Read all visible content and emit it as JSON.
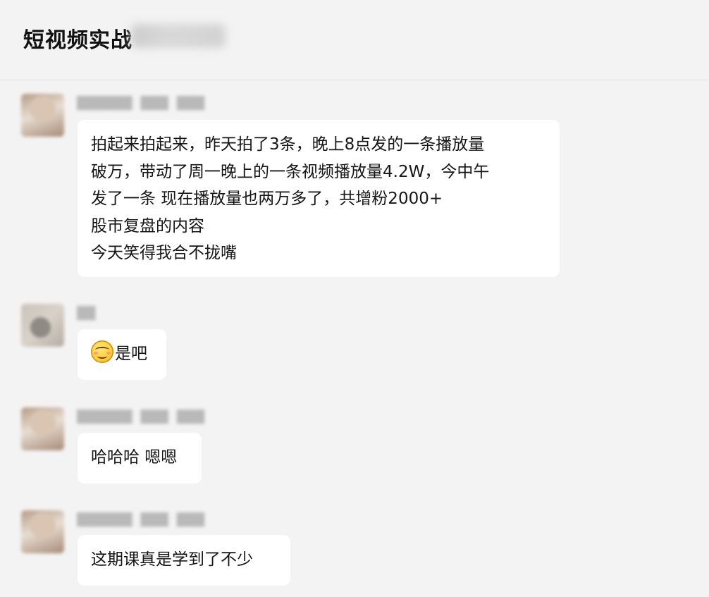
{
  "chat": {
    "title": "短视频实战",
    "title_redacted": "████"
  },
  "messages": [
    {
      "sender": {
        "name": "██████",
        "tag1": "███",
        "tag2": "███"
      },
      "lines": [
        "拍起来拍起来，昨天拍了3条，晚上8点发的一条播放量",
        "破万，带动了周一晚上的一条视频播放量4.2W，今中午",
        "发了一条 现在播放量也两万多了，共增粉2000+",
        "股市复盘的内容",
        "今天笑得我合不拢嘴"
      ]
    },
    {
      "sender": {
        "name": "██"
      },
      "emoji": "smirk-emoji",
      "lines": [
        "是吧"
      ]
    },
    {
      "sender": {
        "name": "██████",
        "tag1": "███",
        "tag2": "███"
      },
      "lines": [
        "哈哈哈 嗯嗯"
      ]
    },
    {
      "sender": {
        "name": "██████",
        "tag1": "███",
        "tag2": "███"
      },
      "lines": [
        "这期课真是学到了不少"
      ]
    }
  ]
}
